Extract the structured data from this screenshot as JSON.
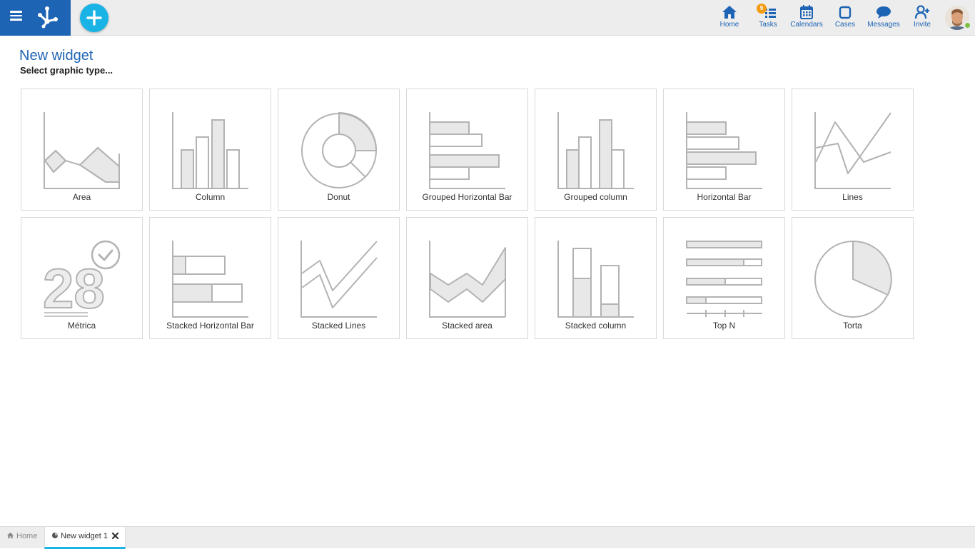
{
  "header": {
    "nav": [
      {
        "id": "home",
        "label": "Home",
        "icon": "home-icon"
      },
      {
        "id": "tasks",
        "label": "Tasks",
        "icon": "tasks-icon",
        "badge": "9"
      },
      {
        "id": "calendars",
        "label": "Calendars",
        "icon": "calendar-icon"
      },
      {
        "id": "cases",
        "label": "Cases",
        "icon": "cases-icon"
      },
      {
        "id": "messages",
        "label": "Messages",
        "icon": "messages-icon"
      },
      {
        "id": "invite",
        "label": "Invite",
        "icon": "invite-icon"
      }
    ],
    "colors": {
      "brand": "#1e64b4",
      "accent": "#1ab3e6",
      "badge": "#f39c12",
      "online": "#7cc042"
    }
  },
  "page": {
    "title": "New widget",
    "subtitle": "Select graphic type..."
  },
  "widget_types": [
    {
      "label": "Area",
      "icon": "area-chart-icon"
    },
    {
      "label": "Column",
      "icon": "column-chart-icon"
    },
    {
      "label": "Donut",
      "icon": "donut-chart-icon"
    },
    {
      "label": "Grouped Horizontal Bar",
      "icon": "grouped-horizontal-bar-icon"
    },
    {
      "label": "Grouped column",
      "icon": "grouped-column-icon"
    },
    {
      "label": "Horizontal Bar",
      "icon": "horizontal-bar-icon"
    },
    {
      "label": "Lines",
      "icon": "lines-chart-icon"
    },
    {
      "label": "Métrica",
      "icon": "metric-icon"
    },
    {
      "label": "Stacked Horizontal Bar",
      "icon": "stacked-horizontal-bar-icon"
    },
    {
      "label": "Stacked Lines",
      "icon": "stacked-lines-icon"
    },
    {
      "label": "Stacked area",
      "icon": "stacked-area-icon"
    },
    {
      "label": "Stacked column",
      "icon": "stacked-column-icon"
    },
    {
      "label": "Top N",
      "icon": "top-n-icon"
    },
    {
      "label": "Torta",
      "icon": "pie-chart-icon"
    }
  ],
  "metric_icon_text": "28",
  "bottom_tabs": [
    {
      "label": "Home",
      "icon": "home-icon"
    },
    {
      "label": "New widget 1",
      "icon": "widget-pie-icon",
      "active": true
    }
  ]
}
